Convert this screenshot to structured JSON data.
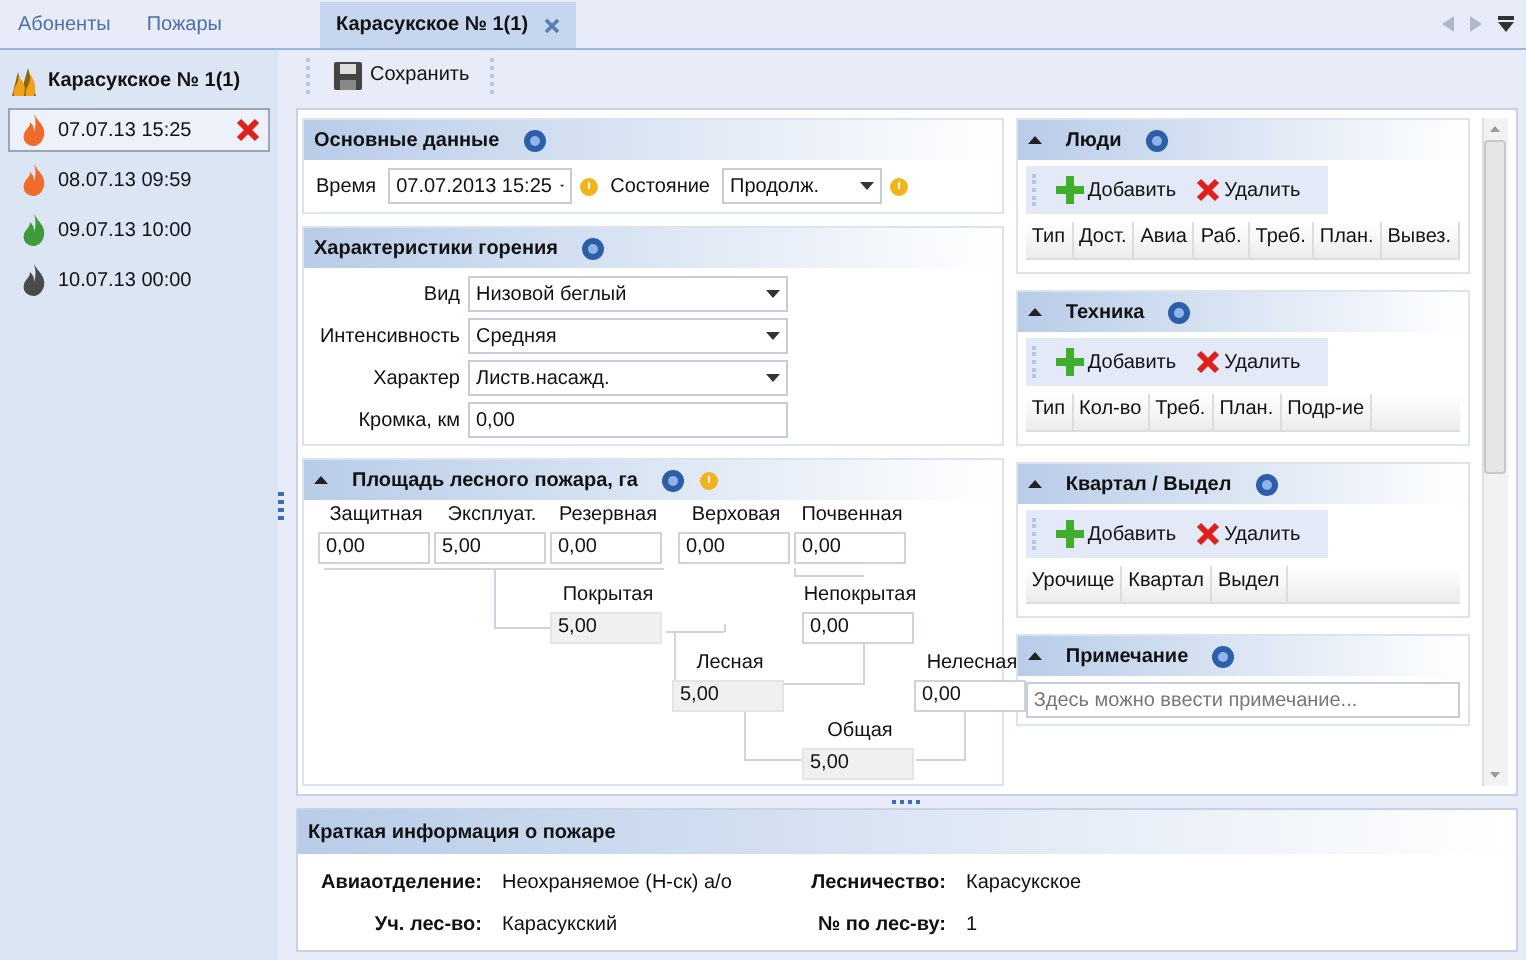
{
  "nav_tabs": [
    {
      "label": "Абоненты",
      "selected": false
    },
    {
      "label": "Пожары",
      "selected": false
    },
    {
      "label": "Карасукское № 1(1)",
      "selected": true
    }
  ],
  "sidebar": {
    "title": "Карасукское № 1(1)",
    "items": [
      {
        "label": "07.07.13 15:25",
        "color": "#f06a28",
        "selected": true
      },
      {
        "label": "08.07.13 09:59",
        "color": "#f06a28",
        "selected": false
      },
      {
        "label": "09.07.13 10:00",
        "color": "#3f9a3a",
        "selected": false
      },
      {
        "label": "10.07.13 00:00",
        "color": "#4a4a4a",
        "selected": false
      }
    ]
  },
  "toolbar": {
    "save": "Сохранить"
  },
  "basic": {
    "title": "Основные данные",
    "time_label": "Время",
    "time_value": "07.07.2013 15:25",
    "state_label": "Состояние",
    "state_value": "Продолж."
  },
  "burning": {
    "title": "Характеристики горения",
    "fields": [
      {
        "label": "Вид",
        "value": "Низовой беглый",
        "kind": "dropdown"
      },
      {
        "label": "Интенсивность",
        "value": "Средняя",
        "kind": "dropdown"
      },
      {
        "label": "Характер",
        "value": "Листв.насажд.",
        "kind": "dropdown"
      },
      {
        "label": "Кромка, км",
        "value": "0,00",
        "kind": "text"
      }
    ]
  },
  "area": {
    "title": "Площадь лесного пожара, га",
    "fields": [
      {
        "label": "Защитная",
        "value": "0,00",
        "kind": "input"
      },
      {
        "label": "Эксплуат.",
        "value": "5,00",
        "kind": "input"
      },
      {
        "label": "Резервная",
        "value": "0,00",
        "kind": "input"
      },
      {
        "label": "Верховая",
        "value": "0,00",
        "kind": "input"
      },
      {
        "label": "Почвенная",
        "value": "0,00",
        "kind": "input"
      },
      {
        "label": "Покрытая",
        "value": "5,00",
        "kind": "computed"
      },
      {
        "label": "Непокрытая",
        "value": "0,00",
        "kind": "input"
      },
      {
        "label": "Лесная",
        "value": "5,00",
        "kind": "computed"
      },
      {
        "label": "Нелесная",
        "value": "0,00",
        "kind": "input"
      },
      {
        "label": "Общая",
        "value": "5,00",
        "kind": "computed"
      }
    ]
  },
  "grids": [
    {
      "title": "Люди",
      "add": "Добавить",
      "delete": "Удалить",
      "columns": [
        "Тип",
        "Дост.",
        "Авиа",
        "Раб.",
        "Треб.",
        "План.",
        "Вывез."
      ]
    },
    {
      "title": "Техника",
      "add": "Добавить",
      "delete": "Удалить",
      "columns": [
        "Тип",
        "Кол-во",
        "Треб.",
        "План.",
        "Подр-ие"
      ]
    },
    {
      "title": "Квартал / Выдел",
      "add": "Добавить",
      "delete": "Удалить",
      "columns": [
        "Урочище",
        "Квартал",
        "Выдел"
      ]
    }
  ],
  "note": {
    "title": "Примечание",
    "placeholder": "Здесь можно ввести примечание..."
  },
  "summary": {
    "title": "Краткая информация о пожаре",
    "rows": [
      {
        "label": "Авиаотделение:",
        "value": "Неохраняемое (Н-ск) а/о"
      },
      {
        "label": "Лесничество:",
        "value": "Карасукское"
      },
      {
        "label": "Уч. лес-во:",
        "value": "Карасукский"
      },
      {
        "label": "№ по лес-ву:",
        "value": "1"
      }
    ]
  }
}
